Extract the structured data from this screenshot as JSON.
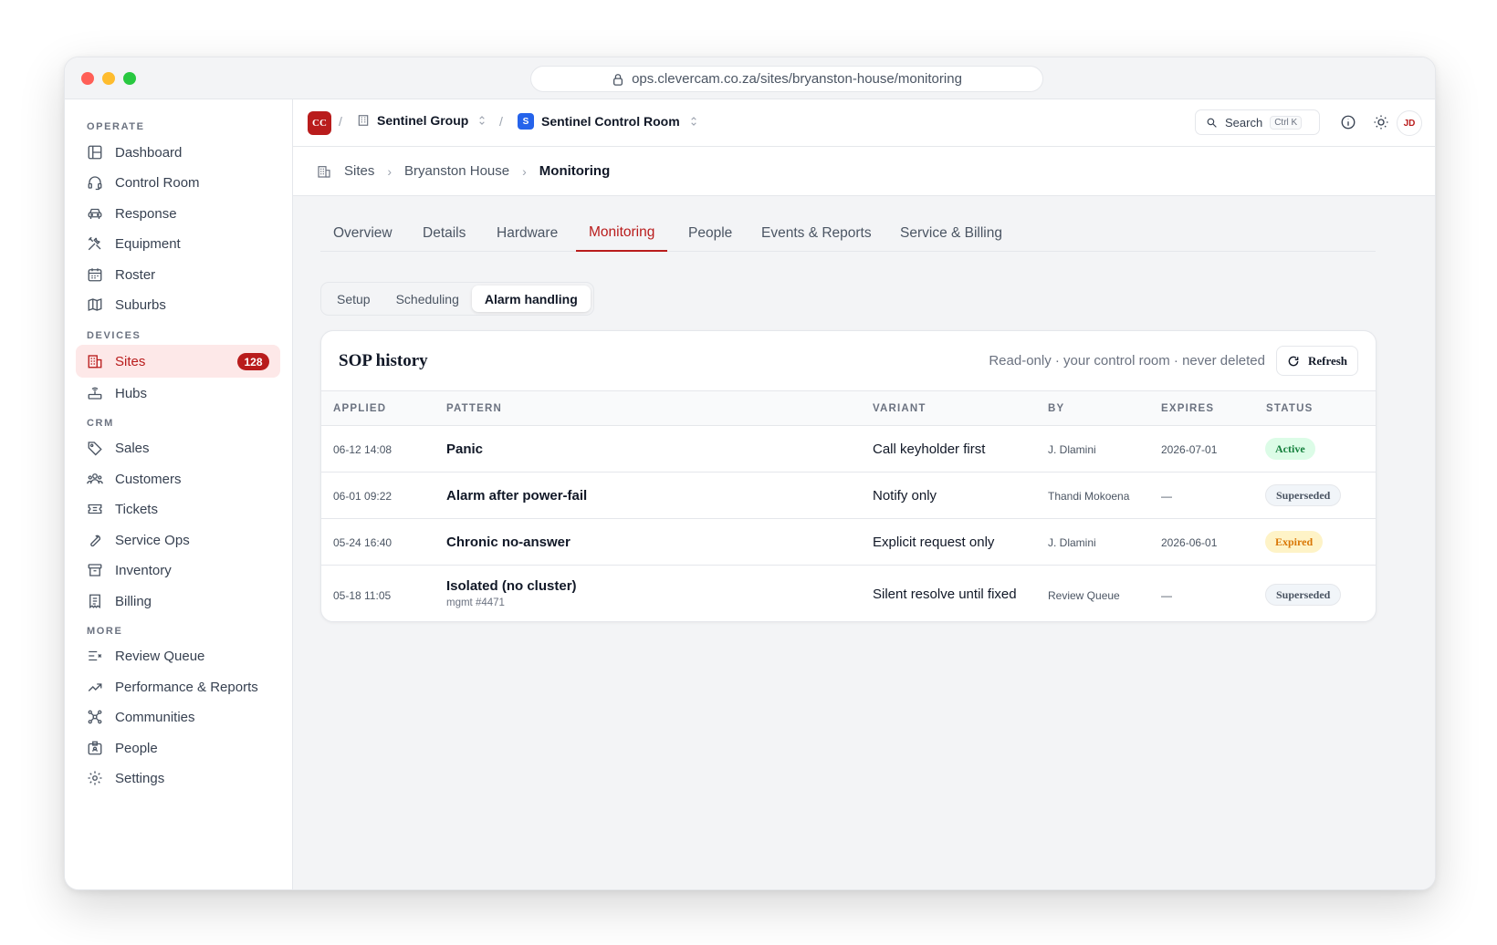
{
  "browser": {
    "url": "ops.clevercam.co.za/sites/bryanston-house/monitoring"
  },
  "sidebar": {
    "sections": [
      {
        "label": "OPERATE",
        "items": [
          {
            "label": "Dashboard",
            "icon": "layout-icon"
          },
          {
            "label": "Control Room",
            "icon": "headset-icon"
          },
          {
            "label": "Response",
            "icon": "car-icon"
          },
          {
            "label": "Equipment",
            "icon": "tools-icon"
          },
          {
            "label": "Roster",
            "icon": "calendar-icon"
          },
          {
            "label": "Suburbs",
            "icon": "map-icon"
          }
        ]
      },
      {
        "label": "DEVICES",
        "items": [
          {
            "label": "Sites",
            "icon": "building-icon",
            "badge": "128",
            "active": true
          },
          {
            "label": "Hubs",
            "icon": "router-icon"
          }
        ]
      },
      {
        "label": "CRM",
        "items": [
          {
            "label": "Sales",
            "icon": "tag-icon"
          },
          {
            "label": "Customers",
            "icon": "users-icon"
          },
          {
            "label": "Tickets",
            "icon": "ticket-icon"
          },
          {
            "label": "Service Ops",
            "icon": "wrench-icon"
          },
          {
            "label": "Inventory",
            "icon": "archive-icon"
          },
          {
            "label": "Billing",
            "icon": "receipt-icon"
          }
        ]
      },
      {
        "label": "MORE",
        "items": [
          {
            "label": "Review Queue",
            "icon": "list-check-icon"
          },
          {
            "label": "Performance & Reports",
            "icon": "trend-icon"
          },
          {
            "label": "Communities",
            "icon": "network-icon"
          },
          {
            "label": "People",
            "icon": "id-card-icon"
          },
          {
            "label": "Settings",
            "icon": "gear-icon"
          }
        ]
      }
    ]
  },
  "topbar": {
    "logo": "CC",
    "org": "Sentinel Group",
    "room_badge": "S",
    "room": "Sentinel Control Room",
    "search_label": "Search",
    "search_shortcut": "Ctrl K",
    "avatar": "JD"
  },
  "breadcrumb": {
    "root": "Sites",
    "site": "Bryanston House",
    "current": "Monitoring"
  },
  "tabs": [
    "Overview",
    "Details",
    "Hardware",
    "Monitoring",
    "People",
    "Events & Reports",
    "Service & Billing"
  ],
  "active_tab": "Monitoring",
  "subtabs": [
    "Setup",
    "Scheduling",
    "Alarm handling"
  ],
  "active_subtab": "Alarm handling",
  "sop": {
    "title": "SOP history",
    "note": "Read-only · your control room · never deleted",
    "refresh_label": "Refresh",
    "columns": {
      "applied": "APPLIED",
      "pattern": "PATTERN",
      "variant": "VARIANT",
      "by": "BY",
      "expires": "EXPIRES",
      "status": "STATUS"
    },
    "rows": [
      {
        "applied": "06-12 14:08",
        "pattern": "Panic",
        "sub": "",
        "variant": "Call keyholder first",
        "by": "J. Dlamini",
        "expires": "2026-07-01",
        "status": "Active",
        "status_type": "active"
      },
      {
        "applied": "06-01 09:22",
        "pattern": "Alarm after power-fail",
        "sub": "",
        "variant": "Notify only",
        "by": "Thandi Mokoena",
        "expires": "—",
        "status": "Superseded",
        "status_type": "superseded"
      },
      {
        "applied": "05-24 16:40",
        "pattern": "Chronic no-answer",
        "sub": "",
        "variant": "Explicit request only",
        "by": "J. Dlamini",
        "expires": "2026-06-01",
        "status": "Expired",
        "status_type": "expired"
      },
      {
        "applied": "05-18 11:05",
        "pattern": "Isolated (no cluster)",
        "sub": "mgmt #4471",
        "variant": "Silent resolve until fixed",
        "by": "Review Queue",
        "expires": "—",
        "status": "Superseded",
        "status_type": "superseded"
      }
    ]
  },
  "colors": {
    "accent": "#b91c1c",
    "active_status": "#15803d",
    "expired_status": "#d97706",
    "room_badge": "#2563eb"
  }
}
